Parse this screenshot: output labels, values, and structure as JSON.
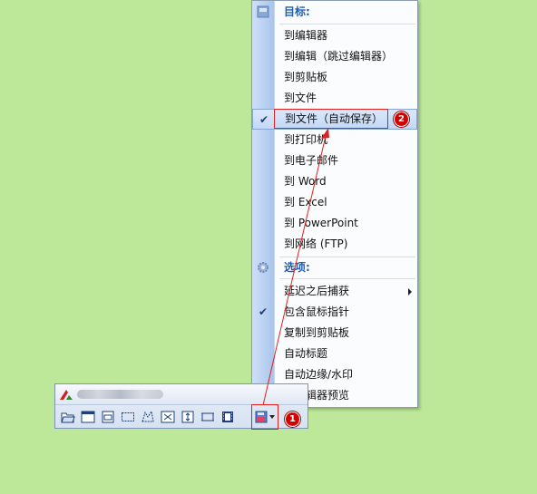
{
  "menu": {
    "header_target": "目标:",
    "items_target": [
      {
        "label": "到编辑器",
        "checked": false
      },
      {
        "label": "到编辑（跳过编辑器）",
        "checked": false
      },
      {
        "label": "到剪贴板",
        "checked": false
      },
      {
        "label": "到文件",
        "checked": false
      },
      {
        "label": "到文件（自动保存）",
        "checked": true,
        "selected": true
      },
      {
        "label": "到打印机",
        "checked": false
      },
      {
        "label": "到电子邮件",
        "checked": false
      },
      {
        "label": "到 Word",
        "checked": false
      },
      {
        "label": "到 Excel",
        "checked": false
      },
      {
        "label": "到 PowerPoint",
        "checked": false
      },
      {
        "label": "到网络 (FTP)",
        "checked": false
      }
    ],
    "header_options": "选项:",
    "items_options": [
      {
        "label": "延迟之后捕获",
        "checked": false,
        "submenu": true
      },
      {
        "label": "包含鼠标指针",
        "checked": true
      },
      {
        "label": "复制到剪贴板",
        "checked": false
      },
      {
        "label": "自动标题",
        "checked": false
      },
      {
        "label": "自动边缘/水印",
        "checked": false
      },
      {
        "label": "在编辑器预览",
        "checked": false
      }
    ]
  },
  "annotations": {
    "badge1": "1",
    "badge2": "2"
  },
  "toolbar": {
    "icons": [
      "open-folder-icon",
      "window-icon",
      "window-region-icon",
      "rectangle-region-icon",
      "freehand-region-icon",
      "fullscreen-icon",
      "scrolling-window-icon",
      "fixed-region-icon",
      "film-icon",
      "output-target-icon"
    ]
  },
  "colors": {
    "background": "#bde89a",
    "annotation": "#e02020",
    "menu_header": "#1f5fb4"
  }
}
